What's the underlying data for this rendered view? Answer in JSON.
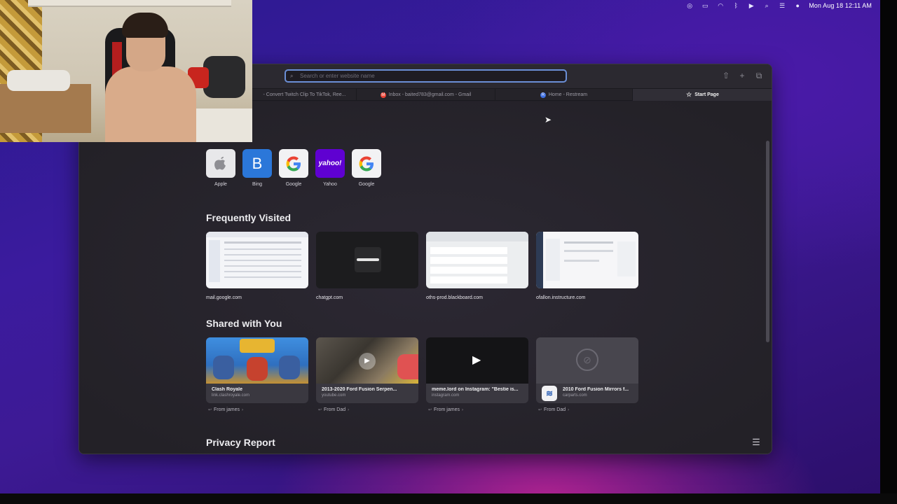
{
  "menubar": {
    "clock": "Mon Aug 18  12:11 AM",
    "icons": [
      "screen-record-icon",
      "battery-icon",
      "wifi-icon",
      "bluetooth-icon",
      "play-icon",
      "search-icon",
      "control-center-icon",
      "siri-icon"
    ]
  },
  "browser": {
    "address": {
      "placeholder": "Search or enter website name",
      "value": ""
    },
    "tabs": [
      {
        "label": "- Convert Twitch Clip To TikTok, Ree..."
      },
      {
        "label": "Inbox - baited783@gmail.com - Gmail"
      },
      {
        "label": "Home - Restream"
      },
      {
        "label": "Start Page"
      }
    ]
  },
  "favorites": {
    "items": [
      {
        "label": "Apple",
        "glyph": ""
      },
      {
        "label": "Bing",
        "glyph": "B"
      },
      {
        "label": "Google",
        "glyph": "G"
      },
      {
        "label": "Yahoo",
        "glyph": "yahoo!"
      },
      {
        "label": "Google",
        "glyph": "G"
      }
    ]
  },
  "frequently_visited": {
    "title": "Frequently Visited",
    "items": [
      {
        "label": "mail.google.com"
      },
      {
        "label": "chatgpt.com"
      },
      {
        "label": "oths-prod.blackboard.com"
      },
      {
        "label": "ofallon.instructure.com"
      }
    ]
  },
  "shared": {
    "title": "Shared with You",
    "items": [
      {
        "title": "Clash Royale",
        "domain": "link.clashroyale.com",
        "from": "From james"
      },
      {
        "title": "2013-2020 Ford Fusion Serpen...",
        "domain": "youtube.com",
        "from": "From Dad"
      },
      {
        "title": "meme.lord on Instagram: \"Bestie is...",
        "domain": "instagram.com",
        "from": "From james"
      },
      {
        "title": "2010 Ford Fusion Mirrors f...",
        "domain": "carparts.com",
        "from": "From Dad"
      }
    ]
  },
  "privacy": {
    "title": "Privacy Report"
  },
  "colors": {
    "accent": "#6b8fd6",
    "bing": "#2b77d9",
    "yahoo": "#5f01d1"
  }
}
